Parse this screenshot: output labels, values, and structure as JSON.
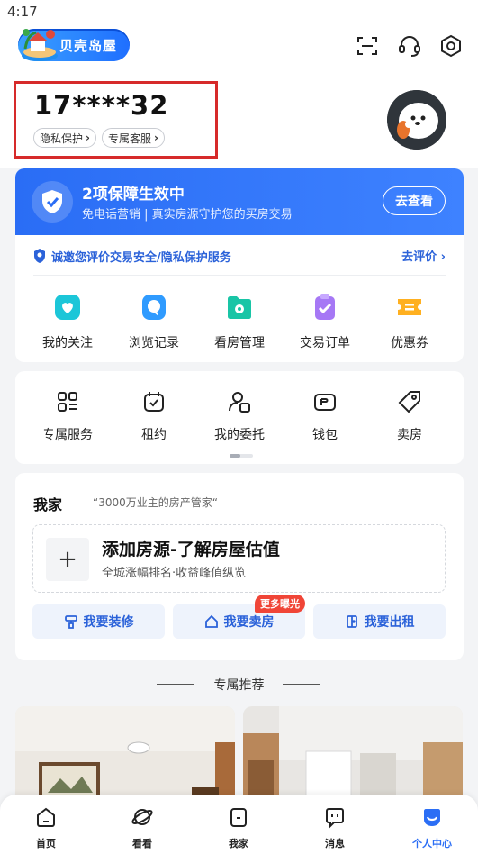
{
  "status": {
    "time": "4:17"
  },
  "header": {
    "logo_text": "贝壳岛屋",
    "icons": [
      "scan-icon",
      "headset-icon",
      "settings-icon"
    ]
  },
  "profile": {
    "phone": "17****32",
    "privacy_label": "隐私保护",
    "service_label": "专属客服"
  },
  "protection": {
    "title": "2项保障生效中",
    "subtitle": "免电话营销 | 真实房源守护您的买房交易",
    "check_button": "去查看",
    "eval_text": "诚邀您评价交易安全/隐私保护服务",
    "eval_link": "去评价"
  },
  "quick_menu": [
    {
      "label": "我的关注",
      "icon": "heart-icon",
      "color": "#1cc6d8"
    },
    {
      "label": "浏览记录",
      "icon": "chat-bubble-icon",
      "color": "#2f9bff"
    },
    {
      "label": "看房管理",
      "icon": "folder-icon",
      "color": "#19c5a6"
    },
    {
      "label": "交易订单",
      "icon": "clipboard-check-icon",
      "color": "#a678f5"
    },
    {
      "label": "优惠券",
      "icon": "ticket-icon",
      "color": "#ffb020"
    }
  ],
  "services": [
    {
      "label": "专属服务",
      "icon": "grid-icon"
    },
    {
      "label": "租约",
      "icon": "calendar-icon"
    },
    {
      "label": "我的委托",
      "icon": "user-doc-icon"
    },
    {
      "label": "钱包",
      "icon": "wallet-icon"
    },
    {
      "label": "卖房",
      "icon": "price-tag-icon"
    }
  ],
  "my_home": {
    "title": "我家",
    "slogan": "“3000万业主的房产管家“",
    "add_title": "添加房源-了解房屋估值",
    "add_subtitle": "全城涨幅排名·收益峰值纵览",
    "buttons": [
      "我要装修",
      "我要卖房",
      "我要出租"
    ],
    "badge": "更多曝光"
  },
  "recommend": {
    "title": "专属推荐"
  },
  "tabbar": [
    {
      "label": "首页",
      "icon": "home-icon",
      "active": false
    },
    {
      "label": "看看",
      "icon": "planet-icon",
      "active": false
    },
    {
      "label": "我家",
      "icon": "house-door-icon",
      "active": false
    },
    {
      "label": "消息",
      "icon": "message-icon",
      "active": false
    },
    {
      "label": "个人中心",
      "icon": "smile-icon",
      "active": true
    }
  ],
  "colors": {
    "primary": "#2b6ef5",
    "accent_red": "#f04537",
    "active_tab": "#2b6ef5"
  }
}
